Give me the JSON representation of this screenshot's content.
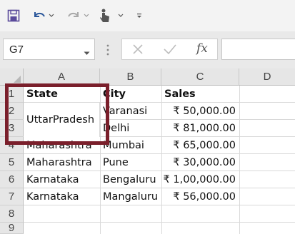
{
  "name_box": {
    "value": "G7"
  },
  "formula_bar": {
    "fx_label": "fx",
    "formula": ""
  },
  "columns": [
    "A",
    "B",
    "C",
    "D"
  ],
  "rows": [
    "1",
    "2",
    "3",
    "4",
    "5",
    "6",
    "7",
    "8",
    "9"
  ],
  "header_row": {
    "state": "State",
    "city": "City",
    "sales": "Sales"
  },
  "merged_cell": {
    "value": "UttarPradesh"
  },
  "cells": {
    "b2": "Varanasi",
    "c2": "₹ 50,000.00",
    "b3": "Delhi",
    "c3": "₹ 81,000.00",
    "a4": "Maharashtra",
    "b4": "Mumbai",
    "c4": "₹ 65,000.00",
    "a5": "Maharashtra",
    "b5": "Pune",
    "c5": "₹ 30,000.00",
    "a6": "Karnataka",
    "b6": "Bengaluru",
    "c6": "₹ 1,00,000.00",
    "a7": "Karnataka",
    "b7": "Mangaluru",
    "c7": "₹ 56,000.00"
  },
  "colors": {
    "highlight_border": "#7a1f2b",
    "save_icon": "#5a4a9b",
    "undo_icon": "#2b579a"
  },
  "icons": [
    "save-icon",
    "undo-icon",
    "redo-icon",
    "touch-mode-icon",
    "customize-qat-icon",
    "cancel-icon",
    "enter-icon",
    "function-icon"
  ]
}
